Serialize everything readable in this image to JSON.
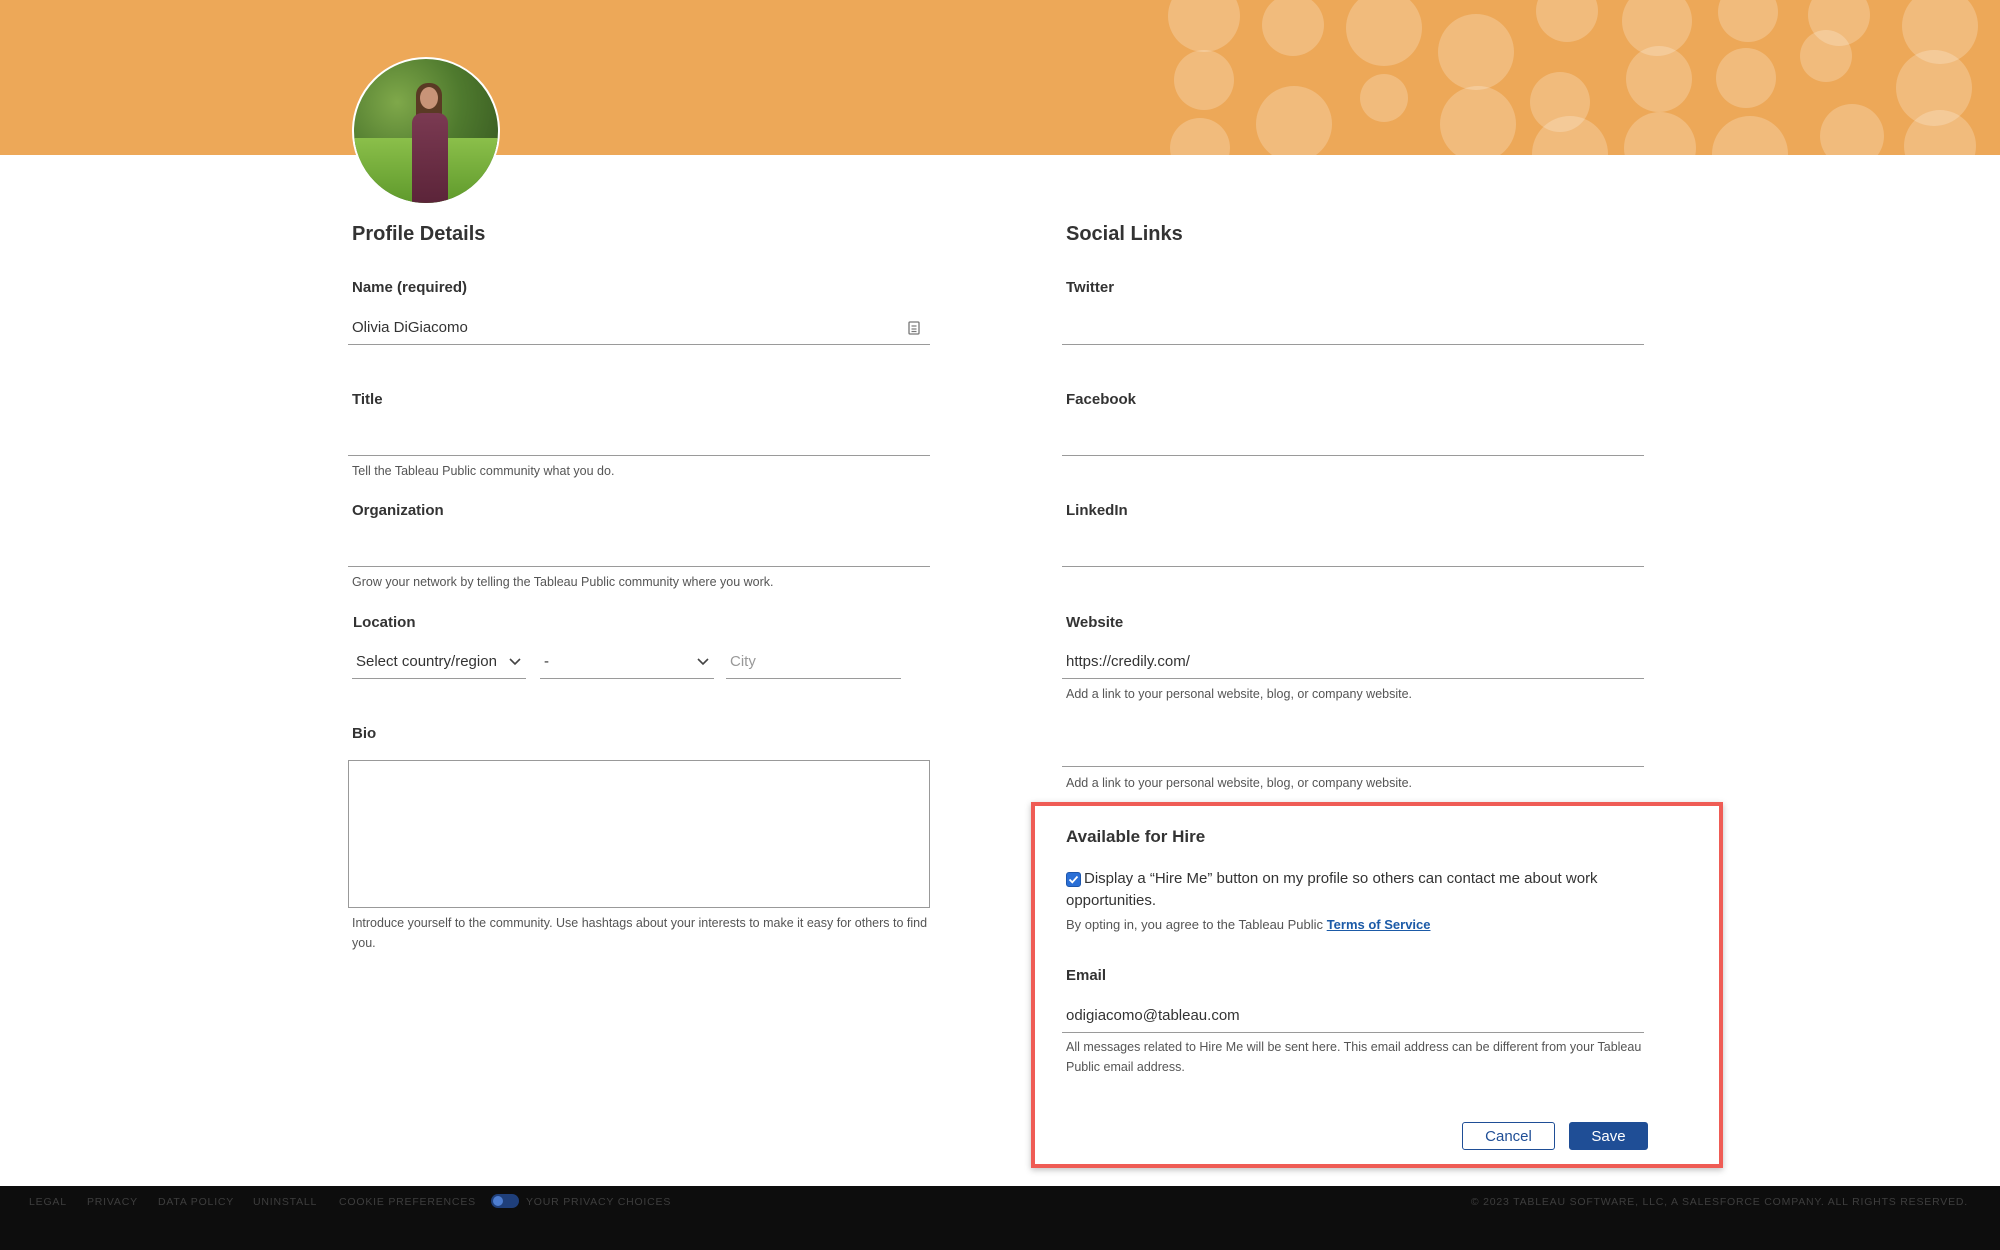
{
  "profile": {
    "heading": "Profile Details",
    "name": {
      "label": "Name (required)",
      "value": "Olivia DiGiacomo"
    },
    "title": {
      "label": "Title",
      "value": "",
      "help": "Tell the Tableau Public community what you do."
    },
    "organization": {
      "label": "Organization",
      "value": "",
      "help": "Grow your network by telling the Tableau Public community where you work."
    },
    "location": {
      "label": "Location",
      "country": "Select country/region",
      "state": "-",
      "city_placeholder": "City"
    },
    "bio": {
      "label": "Bio",
      "value": "",
      "help": "Introduce yourself to the community. Use hashtags about your interests to make it easy for others to find you."
    }
  },
  "social": {
    "heading": "Social Links",
    "twitter": {
      "label": "Twitter",
      "value": ""
    },
    "facebook": {
      "label": "Facebook",
      "value": ""
    },
    "linkedin": {
      "label": "LinkedIn",
      "value": ""
    },
    "website": {
      "label": "Website",
      "value": "https://credily.com/",
      "help": "Add a link to your personal website, blog, or company website."
    },
    "website2": {
      "value": "",
      "help": "Add a link to your personal website, blog, or company website."
    }
  },
  "hire": {
    "heading": "Available for Hire",
    "checked": true,
    "checkbox_text": "Display a “Hire Me” button on my profile so others can contact me about work opportunities.",
    "terms_prefix": "By opting in, you agree to the Tableau Public",
    "terms_link": "Terms of Service",
    "email": {
      "label": "Email",
      "value": "odigiacomo@tableau.com",
      "help": "All messages related to Hire Me will be sent here. This email address can be different from your Tableau Public email address."
    },
    "cancel": "Cancel",
    "save": "Save"
  },
  "footer": {
    "links": [
      "LEGAL",
      "PRIVACY",
      "DATA POLICY",
      "UNINSTALL",
      "COOKIE PREFERENCES",
      "YOUR PRIVACY CHOICES"
    ],
    "copyright": "© 2023 TABLEAU SOFTWARE, LLC, A SALESFORCE COMPANY. ALL RIGHTS RESERVED."
  },
  "colors": {
    "banner": "#eda858",
    "highlight_border": "#ef5c55",
    "primary": "#1f4e96",
    "footer_bg": "#0d0d0d"
  }
}
